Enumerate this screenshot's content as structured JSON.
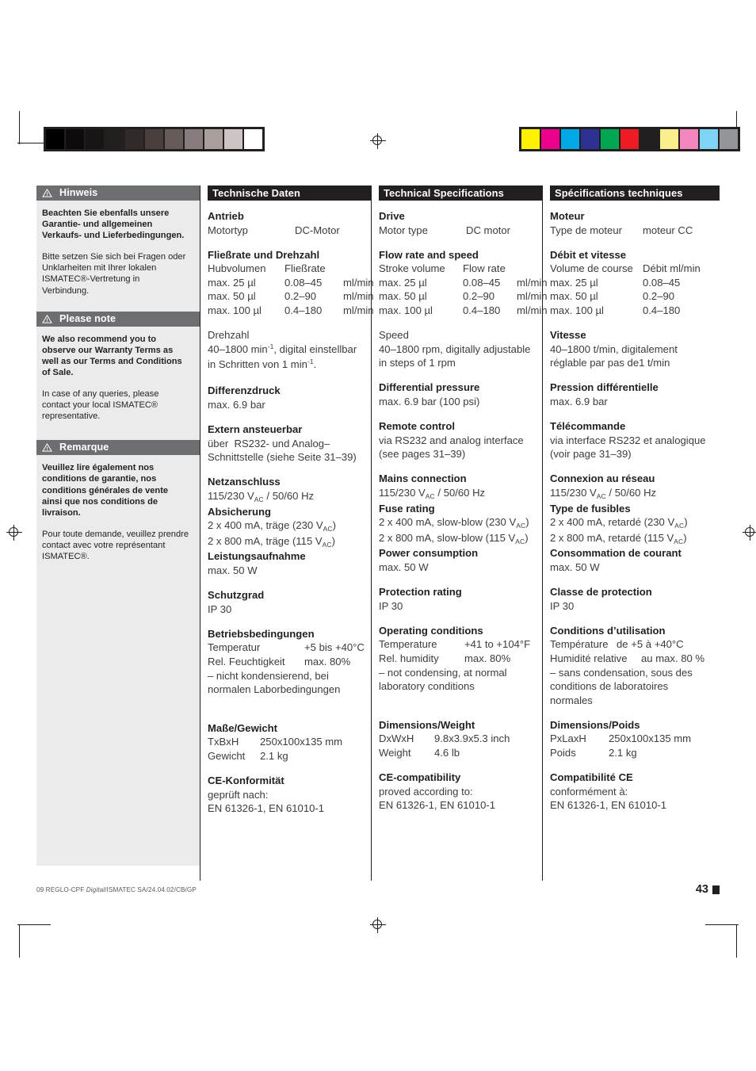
{
  "document": {
    "footer_code_prefix": "09 REGLO-CPF ",
    "footer_code_italic": "Digital",
    "footer_code_suffix": "/ISMATEC SA/24.04.02/CB/GP",
    "page_number": "43"
  },
  "calibration": {
    "grey_swatches": [
      "#000000",
      "#0d0b0b",
      "#191515",
      "#231f1f",
      "#302a29",
      "#493f3d",
      "#655b59",
      "#867d7c",
      "#a99f9d",
      "#cdc5c4",
      "#ffffff"
    ],
    "color_swatches": [
      "#fff200",
      "#ec008c",
      "#00a9e6",
      "#2e3192",
      "#00a651",
      "#ed1c24",
      "#231f20",
      "#fbee8c",
      "#f386bd",
      "#7fd4f5",
      "#939598"
    ]
  },
  "notes": [
    {
      "icon": "warning-triangle-icon",
      "title": "Hinweis",
      "paragraphs": [
        {
          "bold": true,
          "text": "Beachten Sie ebenfalls unsere Garantie- und allgemeinen Verkaufs- und Lieferbedingungen."
        },
        {
          "bold": false,
          "text": "Bitte setzen Sie sich bei Fragen oder Unklarheiten mit Ihrer lokalen ISMATEC®-Vertretung in Verbindung."
        }
      ]
    },
    {
      "icon": "warning-triangle-icon",
      "title": "Please note",
      "paragraphs": [
        {
          "bold": true,
          "text": "We also recommend you to observe our Warranty Terms as well as our Terms and Conditions of Sale."
        },
        {
          "bold": false,
          "text": "In case of any queries, please contact your local ISMATEC® representative."
        }
      ]
    },
    {
      "icon": "warning-triangle-icon",
      "title": "Remarque",
      "paragraphs": [
        {
          "bold": true,
          "text": "Veuillez lire également nos conditions de garantie, nos conditions générales de vente ainsi que nos conditions de livraison."
        },
        {
          "bold": false,
          "text": "Pour toute demande, veuillez prendre contact avec votre représentant ISMATEC®."
        }
      ]
    }
  ],
  "de": {
    "header": "Technische Daten",
    "drive": {
      "title": "Antrieb",
      "label": "Motortyp",
      "value": "DC-Motor"
    },
    "flow": {
      "title": "Fließrate und Drehzahl",
      "col1": "Hubvolumen",
      "col2": "Fließrate",
      "rows": [
        {
          "stroke": "max. 25 µl",
          "rate": "0.08–45",
          "unit": "ml/min"
        },
        {
          "stroke": "max. 50 µl",
          "rate": "0.2–90",
          "unit": "ml/min"
        },
        {
          "stroke": "max. 100 µl",
          "rate": "0.4–180",
          "unit": "ml/min"
        }
      ]
    },
    "speed": {
      "title": "Drehzahl",
      "line1a": "40–1800 min",
      "line1b": ", digital einstellbar",
      "line2a": "in Schritten von 1 min",
      "line2b": "."
    },
    "pressure": {
      "title": "Differenzdruck",
      "value": "max. 6.9 bar"
    },
    "remote": {
      "title": "Extern ansteuerbar",
      "line1": "über  RS232- und Analog–",
      "line2": "Schnittstelle (siehe Seite 31–39)"
    },
    "mains": {
      "title": "Netzanschluss",
      "value_a": "115/230 V",
      "value_b": " / 50/60 Hz",
      "fuse_title": "Absicherung",
      "fuse1_a": "2 x 400 mA, träge (230 V",
      "fuse1_b": ")",
      "fuse2_a": "2 x 800 mA, träge (115 V",
      "fuse2_b": ")",
      "power_title": "Leistungsaufnahme",
      "power_value": "max. 50 W"
    },
    "protection": {
      "title": "Schutzgrad",
      "value": "IP 30"
    },
    "operating": {
      "title": "Betriebsbedingungen",
      "temp_label": "Temperatur",
      "temp_value": "+5 bis +40°C",
      "hum_label": "Rel. Feuchtigkeit",
      "hum_value": "max. 80%",
      "line3": "– nicht kondensierend, bei",
      "line4": "normalen Laborbedingungen"
    },
    "dimensions": {
      "title": "Maße/Gewicht",
      "dim_label": "TxBxH",
      "dim_value": "250x100x135 mm",
      "weight_label": "Gewicht",
      "weight_value": "2.1 kg"
    },
    "ce": {
      "title": "CE-Konformität",
      "line1": "geprüft nach:",
      "line2": "EN 61326-1, EN 61010-1"
    }
  },
  "en": {
    "header": "Technical Specifications",
    "drive": {
      "title": "Drive",
      "label": "Motor type",
      "value": "DC motor"
    },
    "flow": {
      "title": "Flow rate and speed",
      "col1": "Stroke volume",
      "col2": "Flow rate",
      "rows": [
        {
          "stroke": "max. 25 µl",
          "rate": "0.08–45",
          "unit": "ml/min"
        },
        {
          "stroke": "max. 50 µl",
          "rate": "0.2–90",
          "unit": "ml/min"
        },
        {
          "stroke": "max. 100 µl",
          "rate": "0.4–180",
          "unit": "ml/min"
        }
      ]
    },
    "speed": {
      "title": "Speed",
      "line1": "40–1800 rpm, digitally adjustable",
      "line2": "in steps of 1 rpm"
    },
    "pressure": {
      "title": "Differential pressure",
      "value": "max. 6.9 bar (100 psi)"
    },
    "remote": {
      "title": "Remote control",
      "line1": "via RS232 and analog interface",
      "line2": "(see pages 31–39)"
    },
    "mains": {
      "title": "Mains connection",
      "value_a": "115/230 V",
      "value_b": " / 50/60 Hz",
      "fuse_title": "Fuse rating",
      "fuse1_a": "2 x 400 mA, slow-blow (230 V",
      "fuse1_b": ")",
      "fuse2_a": "2 x 800 mA, slow-blow (115 V",
      "fuse2_b": ")",
      "power_title": "Power consumption",
      "power_value": "max. 50 W"
    },
    "protection": {
      "title": "Protection rating",
      "value": "IP 30"
    },
    "operating": {
      "title": "Operating conditions",
      "temp_label": "Temperature",
      "temp_value": "+41 to +104°F",
      "hum_label": "Rel. humidity",
      "hum_value": "max. 80%",
      "line3": "– not condensing, at normal",
      "line4": "laboratory conditions"
    },
    "dimensions": {
      "title": "Dimensions/Weight",
      "dim_label": "DxWxH",
      "dim_value": "9.8x3.9x5.3 inch",
      "weight_label": "Weight",
      "weight_value": "4.6 lb"
    },
    "ce": {
      "title": "CE-compatibility",
      "line1": "proved according to:",
      "line2": "EN 61326-1, EN 61010-1"
    }
  },
  "fr": {
    "header": "Spécifications techniques",
    "drive": {
      "title": "Moteur",
      "label": "Type de moteur",
      "value": "moteur CC"
    },
    "flow": {
      "title": "Débit et vitesse",
      "col1": "Volume de course",
      "col2": "Débit ml/min",
      "rows": [
        {
          "stroke": "max. 25 µl",
          "rate": "0.08–45",
          "unit": ""
        },
        {
          "stroke": "max. 50 µl",
          "rate": "0.2–90",
          "unit": ""
        },
        {
          "stroke": "max. 100 µl",
          "rate": "0.4–180",
          "unit": ""
        }
      ]
    },
    "speed": {
      "title": "Vitesse",
      "line1": "40–1800 t/min, digitalement",
      "line2": "réglable par pas de1 t/min"
    },
    "pressure": {
      "title": "Pression différentielle",
      "value": "max. 6.9 bar"
    },
    "remote": {
      "title": "Télécommande",
      "line1": "via interface RS232 et analogique",
      "line2": "(voir page 31–39)"
    },
    "mains": {
      "title": "Connexion au réseau",
      "value_a": "115/230 V",
      "value_b": " / 50/60 Hz",
      "fuse_title": "Type de fusibles",
      "fuse1_a": "2 x 400 mA, retardé (230 V",
      "fuse1_b": ")",
      "fuse2_a": "2 x 800 mA, retardé (115 V",
      "fuse2_b": ")",
      "power_title": "Consommation de courant",
      "power_value": "max. 50 W"
    },
    "protection": {
      "title": "Classe de protection",
      "value": "IP 30"
    },
    "operating": {
      "title": "Conditions d’utilisation",
      "temp_label": "Température",
      "temp_value": "de +5 à +40°C",
      "hum_label": "Humidité relative",
      "hum_value": "au max. 80 %",
      "line3": "– sans condensation, sous des",
      "line4": "conditions de laboratoires",
      "line5": "normales"
    },
    "dimensions": {
      "title": "Dimensions/Poids",
      "dim_label": "PxLaxH",
      "dim_value": "250x100x135 mm",
      "weight_label": "Poids",
      "weight_value": "2.1 kg"
    },
    "ce": {
      "title": "Compatibilité CE",
      "line1": "conformément à:",
      "line2": "EN 61326-1, EN 61010-1"
    }
  },
  "ac_subscript": "AC",
  "superscript_minus_one": "-1"
}
